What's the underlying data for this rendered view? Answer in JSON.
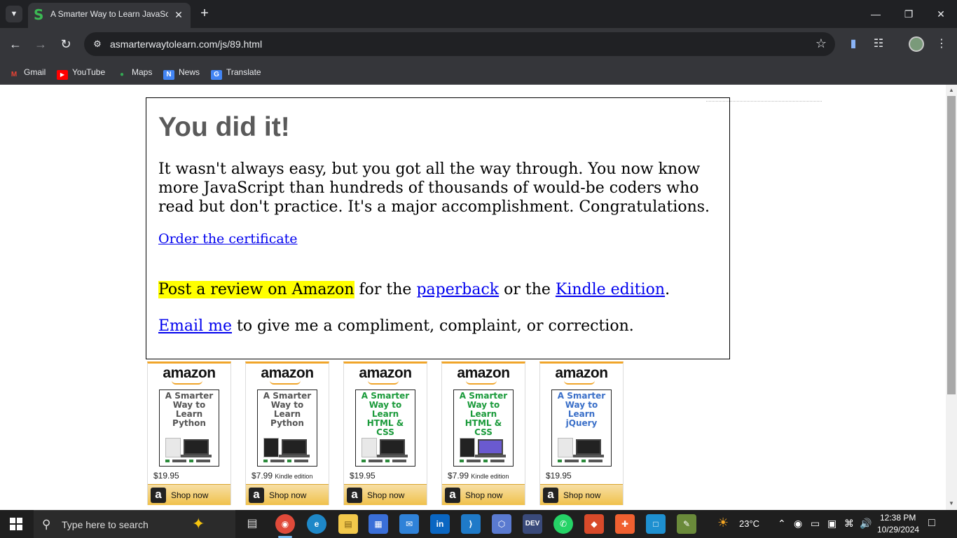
{
  "browser": {
    "tab_title": "A Smarter Way to Learn JavaScript",
    "tab_favicon": "S",
    "url": "asmarterwaytolearn.com/js/89.html",
    "bookmarks": [
      {
        "label": "Gmail",
        "icon": "M",
        "color": "#ea4335"
      },
      {
        "label": "YouTube",
        "icon": "▶",
        "color": "#ff0000"
      },
      {
        "label": "Maps",
        "icon": "●",
        "color": "#34a853"
      },
      {
        "label": "News",
        "icon": "N",
        "color": "#4285f4"
      },
      {
        "label": "Translate",
        "icon": "G",
        "color": "#4285f4"
      }
    ]
  },
  "page": {
    "heading": "You did it!",
    "paragraph": "It wasn't always easy, but you got all the way through. You now know more JavaScript than hundreds of thousands of would-be coders who read but don't practice. It's a major accomplishment. Congratulations.",
    "certificate_link": "Order the certificate",
    "review": {
      "highlight": "Post a review on Amazon",
      "mid1": " for the ",
      "paperback_link": "paperback",
      "mid2": " or the ",
      "kindle_link": "Kindle edition",
      "end": "."
    },
    "email": {
      "link": "Email me",
      "rest": " to give me a compliment, complaint, or correction."
    }
  },
  "ads": [
    {
      "logo": "amazon",
      "title": "A Smarter Way to Learn Python",
      "title_color": "#555555",
      "price": "$19.95",
      "edition": "",
      "button": "Shop now"
    },
    {
      "logo": "amazon",
      "title": "A Smarter Way to Learn Python",
      "title_color": "#555555",
      "price": "$7.99",
      "edition": "Kindle edition",
      "button": "Shop now"
    },
    {
      "logo": "amazon",
      "title": "A Smarter Way to Learn HTML & CSS",
      "title_color": "#1a9a3a",
      "price": "$19.95",
      "edition": "",
      "button": "Shop now"
    },
    {
      "logo": "amazon",
      "title": "A Smarter Way to Learn HTML & CSS",
      "title_color": "#1a9a3a",
      "price": "$7.99",
      "edition": "Kindle edition",
      "button": "Shop now"
    },
    {
      "logo": "amazon",
      "title": "A Smarter Way to Learn jQuery",
      "title_color": "#3a6fc8",
      "price": "$19.95",
      "edition": "",
      "button": "Shop now"
    }
  ],
  "taskbar": {
    "search_placeholder": "Type here to search",
    "temperature": "23°C",
    "time": "12:38 PM",
    "date": "10/29/2024"
  }
}
